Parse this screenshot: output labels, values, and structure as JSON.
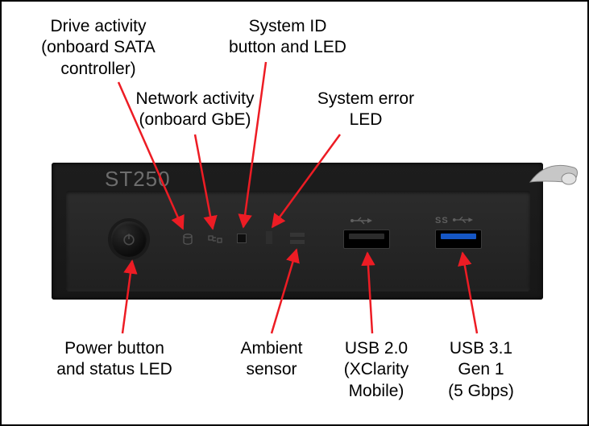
{
  "model_label": "ST250",
  "labels": {
    "drive_activity": "Drive activity\n(onboard SATA\ncontroller)",
    "network_activity": "Network activity\n(onboard GbE)",
    "system_id": "System ID\nbutton and LED",
    "system_error": "System error\nLED",
    "power_button": "Power button\nand status LED",
    "ambient_sensor": "Ambient\nsensor",
    "usb20": "USB 2.0\n(XClarity\nMobile)",
    "usb31": "USB 3.1\nGen 1\n(5 Gbps)"
  },
  "components": {
    "power_button": "power-button",
    "drive_activity_led": "drive-activity-led",
    "network_activity_led": "network-activity-led",
    "system_id_button": "system-id-button",
    "system_error_led": "system-error-led",
    "ambient_sensor": "ambient-sensor",
    "usb20_port": "usb-2.0-port",
    "usb31_port": "usb-3.1-gen1-port"
  },
  "colors": {
    "arrow": "#ed1c24"
  }
}
